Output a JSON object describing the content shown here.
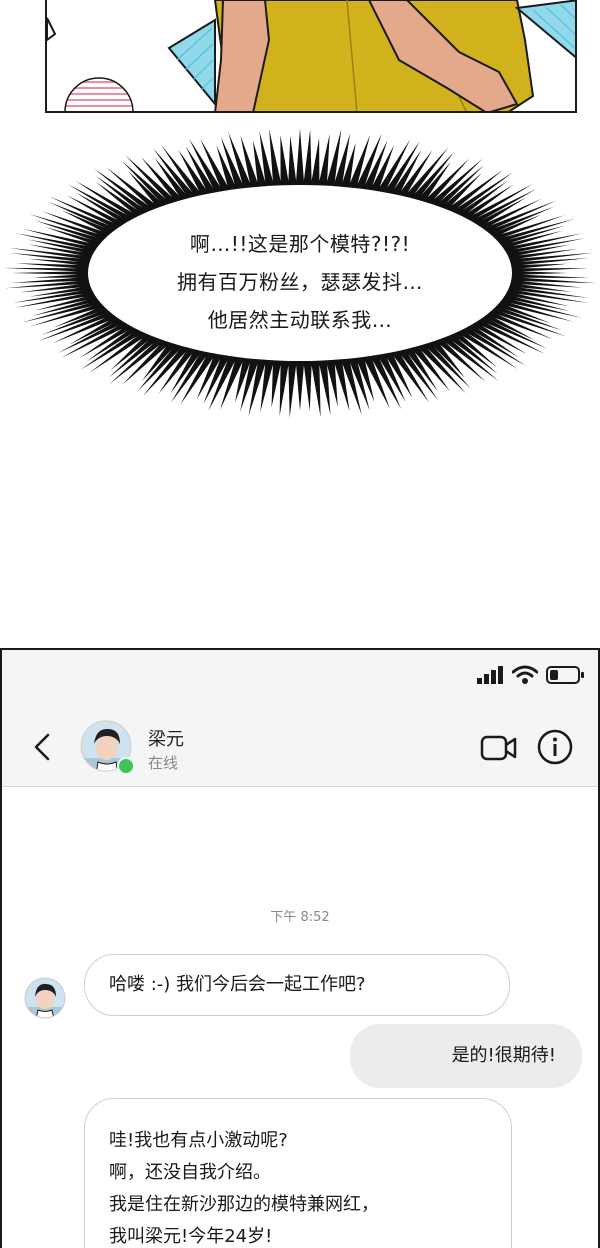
{
  "thought_bubble": {
    "lines": [
      "啊…!!这是那个模特?!?!",
      "拥有百万粉丝，瑟瑟发抖…",
      "他居然主动联系我…"
    ]
  },
  "phone": {
    "status_bar": {
      "icons": [
        "signal-icon",
        "wifi-icon",
        "battery-icon"
      ]
    },
    "header": {
      "contact_name": "梁元",
      "contact_status": "在线",
      "online_color": "#3cc45a"
    },
    "chat": {
      "timestamp": "下午 8:52",
      "messages": [
        {
          "direction": "incoming",
          "lines": [
            "哈喽 :-) 我们今后会一起工作吧?"
          ]
        },
        {
          "direction": "outgoing",
          "lines": [
            "是的!很期待!"
          ]
        },
        {
          "direction": "incoming",
          "lines": [
            "哇!我也有点小激动呢?",
            "啊，还没自我介绍。",
            "我是住在新沙那边的模特兼网红，",
            "我叫梁元!今年24岁!"
          ]
        }
      ]
    }
  }
}
